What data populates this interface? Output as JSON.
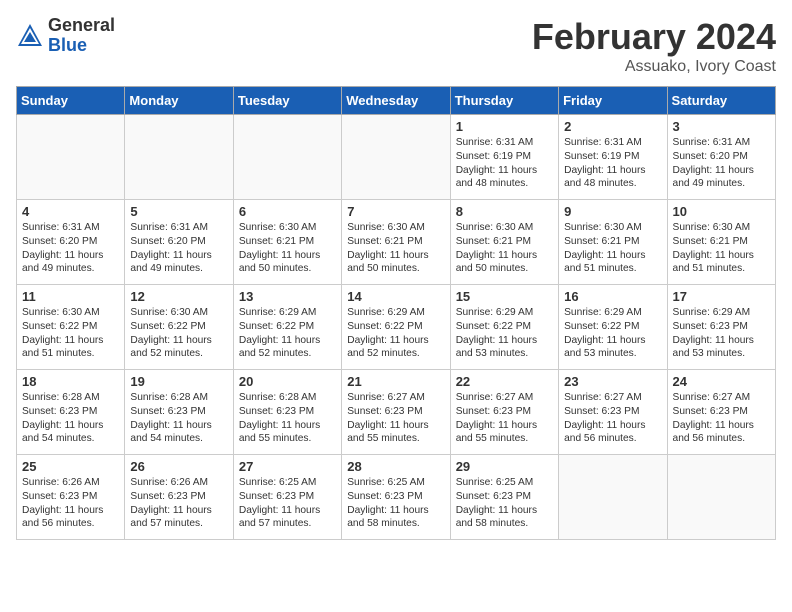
{
  "header": {
    "logo_general": "General",
    "logo_blue": "Blue",
    "month_year": "February 2024",
    "location": "Assuako, Ivory Coast"
  },
  "days_of_week": [
    "Sunday",
    "Monday",
    "Tuesday",
    "Wednesday",
    "Thursday",
    "Friday",
    "Saturday"
  ],
  "weeks": [
    [
      {
        "day": "",
        "content": ""
      },
      {
        "day": "",
        "content": ""
      },
      {
        "day": "",
        "content": ""
      },
      {
        "day": "",
        "content": ""
      },
      {
        "day": "1",
        "content": "Sunrise: 6:31 AM\nSunset: 6:19 PM\nDaylight: 11 hours\nand 48 minutes."
      },
      {
        "day": "2",
        "content": "Sunrise: 6:31 AM\nSunset: 6:19 PM\nDaylight: 11 hours\nand 48 minutes."
      },
      {
        "day": "3",
        "content": "Sunrise: 6:31 AM\nSunset: 6:20 PM\nDaylight: 11 hours\nand 49 minutes."
      }
    ],
    [
      {
        "day": "4",
        "content": "Sunrise: 6:31 AM\nSunset: 6:20 PM\nDaylight: 11 hours\nand 49 minutes."
      },
      {
        "day": "5",
        "content": "Sunrise: 6:31 AM\nSunset: 6:20 PM\nDaylight: 11 hours\nand 49 minutes."
      },
      {
        "day": "6",
        "content": "Sunrise: 6:30 AM\nSunset: 6:21 PM\nDaylight: 11 hours\nand 50 minutes."
      },
      {
        "day": "7",
        "content": "Sunrise: 6:30 AM\nSunset: 6:21 PM\nDaylight: 11 hours\nand 50 minutes."
      },
      {
        "day": "8",
        "content": "Sunrise: 6:30 AM\nSunset: 6:21 PM\nDaylight: 11 hours\nand 50 minutes."
      },
      {
        "day": "9",
        "content": "Sunrise: 6:30 AM\nSunset: 6:21 PM\nDaylight: 11 hours\nand 51 minutes."
      },
      {
        "day": "10",
        "content": "Sunrise: 6:30 AM\nSunset: 6:21 PM\nDaylight: 11 hours\nand 51 minutes."
      }
    ],
    [
      {
        "day": "11",
        "content": "Sunrise: 6:30 AM\nSunset: 6:22 PM\nDaylight: 11 hours\nand 51 minutes."
      },
      {
        "day": "12",
        "content": "Sunrise: 6:30 AM\nSunset: 6:22 PM\nDaylight: 11 hours\nand 52 minutes."
      },
      {
        "day": "13",
        "content": "Sunrise: 6:29 AM\nSunset: 6:22 PM\nDaylight: 11 hours\nand 52 minutes."
      },
      {
        "day": "14",
        "content": "Sunrise: 6:29 AM\nSunset: 6:22 PM\nDaylight: 11 hours\nand 52 minutes."
      },
      {
        "day": "15",
        "content": "Sunrise: 6:29 AM\nSunset: 6:22 PM\nDaylight: 11 hours\nand 53 minutes."
      },
      {
        "day": "16",
        "content": "Sunrise: 6:29 AM\nSunset: 6:22 PM\nDaylight: 11 hours\nand 53 minutes."
      },
      {
        "day": "17",
        "content": "Sunrise: 6:29 AM\nSunset: 6:23 PM\nDaylight: 11 hours\nand 53 minutes."
      }
    ],
    [
      {
        "day": "18",
        "content": "Sunrise: 6:28 AM\nSunset: 6:23 PM\nDaylight: 11 hours\nand 54 minutes."
      },
      {
        "day": "19",
        "content": "Sunrise: 6:28 AM\nSunset: 6:23 PM\nDaylight: 11 hours\nand 54 minutes."
      },
      {
        "day": "20",
        "content": "Sunrise: 6:28 AM\nSunset: 6:23 PM\nDaylight: 11 hours\nand 55 minutes."
      },
      {
        "day": "21",
        "content": "Sunrise: 6:27 AM\nSunset: 6:23 PM\nDaylight: 11 hours\nand 55 minutes."
      },
      {
        "day": "22",
        "content": "Sunrise: 6:27 AM\nSunset: 6:23 PM\nDaylight: 11 hours\nand 55 minutes."
      },
      {
        "day": "23",
        "content": "Sunrise: 6:27 AM\nSunset: 6:23 PM\nDaylight: 11 hours\nand 56 minutes."
      },
      {
        "day": "24",
        "content": "Sunrise: 6:27 AM\nSunset: 6:23 PM\nDaylight: 11 hours\nand 56 minutes."
      }
    ],
    [
      {
        "day": "25",
        "content": "Sunrise: 6:26 AM\nSunset: 6:23 PM\nDaylight: 11 hours\nand 56 minutes."
      },
      {
        "day": "26",
        "content": "Sunrise: 6:26 AM\nSunset: 6:23 PM\nDaylight: 11 hours\nand 57 minutes."
      },
      {
        "day": "27",
        "content": "Sunrise: 6:25 AM\nSunset: 6:23 PM\nDaylight: 11 hours\nand 57 minutes."
      },
      {
        "day": "28",
        "content": "Sunrise: 6:25 AM\nSunset: 6:23 PM\nDaylight: 11 hours\nand 58 minutes."
      },
      {
        "day": "29",
        "content": "Sunrise: 6:25 AM\nSunset: 6:23 PM\nDaylight: 11 hours\nand 58 minutes."
      },
      {
        "day": "",
        "content": ""
      },
      {
        "day": "",
        "content": ""
      }
    ]
  ]
}
